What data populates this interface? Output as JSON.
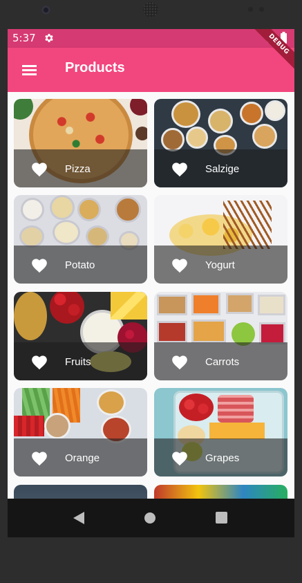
{
  "status_bar": {
    "time": "5:37",
    "icons": [
      "gear-icon",
      "wifi-icon",
      "battery-icon"
    ],
    "color": "#d63a72"
  },
  "debug_banner": "DEBUG",
  "app_bar": {
    "title": "Products",
    "menu_icon": "menu-icon",
    "color": "#f2467e"
  },
  "products": [
    {
      "label": "Pizza",
      "icon": "heart-icon"
    },
    {
      "label": "Salzige",
      "icon": "heart-icon"
    },
    {
      "label": "Potato",
      "icon": "heart-icon"
    },
    {
      "label": "Yogurt",
      "icon": "heart-icon"
    },
    {
      "label": "Fruits",
      "icon": "heart-icon"
    },
    {
      "label": "Carrots",
      "icon": "heart-icon"
    },
    {
      "label": "Orange",
      "icon": "heart-icon"
    },
    {
      "label": "Grapes",
      "icon": "heart-icon"
    }
  ],
  "nav_bar": {
    "icons": [
      "back-icon",
      "home-icon",
      "recents-icon"
    ]
  }
}
